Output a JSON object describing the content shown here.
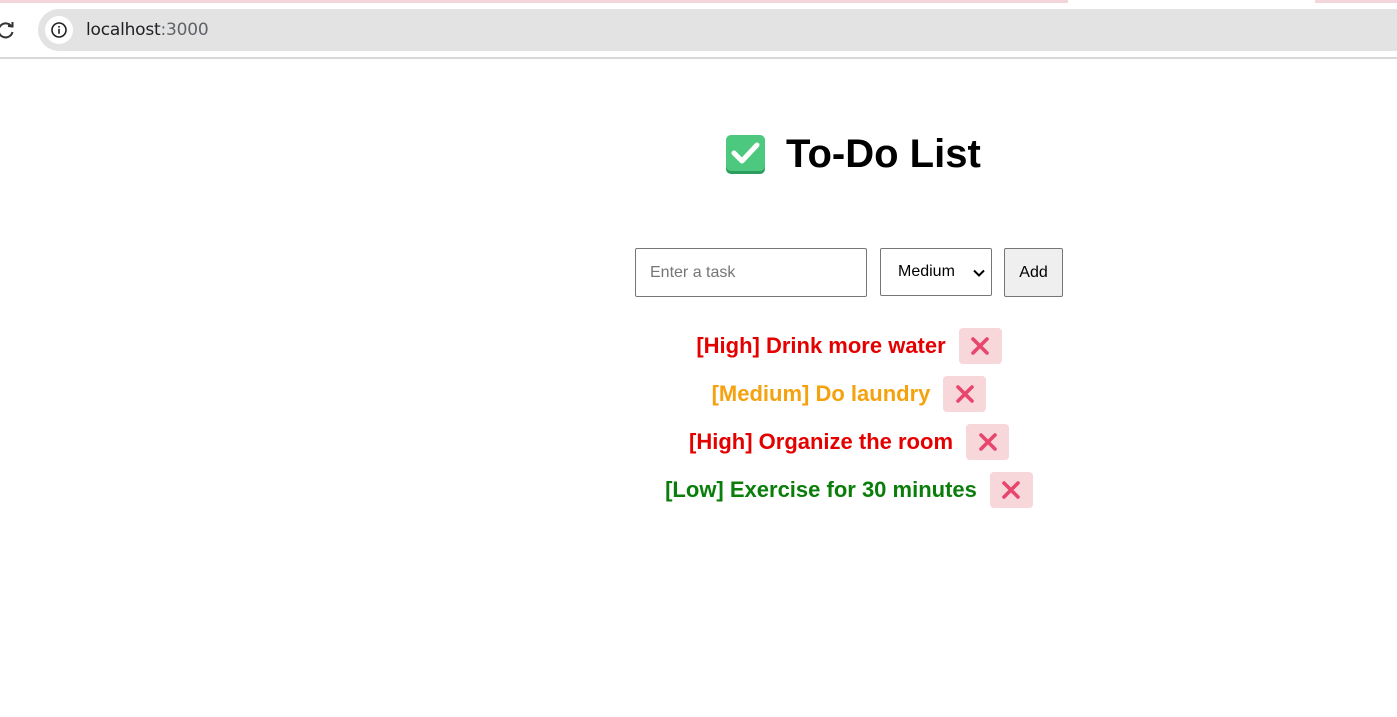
{
  "browser": {
    "url_host": "localhost",
    "url_port": ":3000"
  },
  "app": {
    "title": "To-Do List",
    "title_icon": "check-mark-button-icon",
    "input_placeholder": "Enter a task",
    "input_value": "",
    "priority_selected": "Medium",
    "add_label": "Add"
  },
  "tasks": [
    {
      "text": "[High] Drink more water",
      "priority": "High",
      "color": "#e50000"
    },
    {
      "text": "[Medium] Do laundry",
      "priority": "Medium",
      "color": "#f5a20f"
    },
    {
      "text": "[High] Organize the room",
      "priority": "High",
      "color": "#e50000"
    },
    {
      "text": "[Low] Exercise for 30 minutes",
      "priority": "Low",
      "color": "#0a7d0a"
    }
  ],
  "colors": {
    "delete_bg": "#f8d7da",
    "delete_x": "#e8466d",
    "check_green": "#3cb371"
  }
}
